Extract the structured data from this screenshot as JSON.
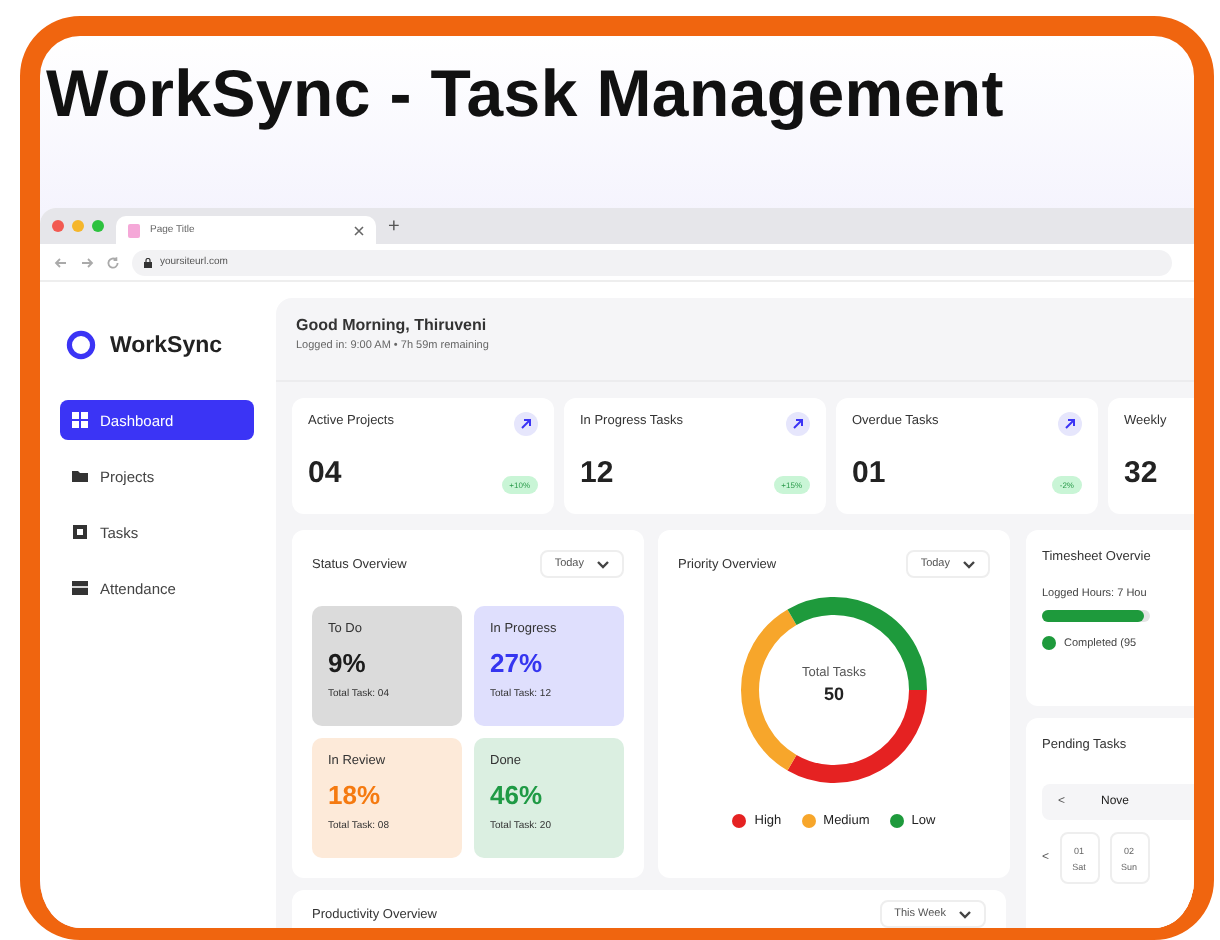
{
  "title": "WorkSync - Task Management",
  "browser": {
    "tab_title": "Page Title",
    "new_tab": "+",
    "address": "yoursiteurl.com"
  },
  "sidebar": {
    "brand": "WorkSync",
    "items": [
      {
        "label": "Dashboard",
        "selected": true,
        "kind": "grid"
      },
      {
        "label": "Projects",
        "selected": false,
        "kind": "folder"
      },
      {
        "label": "Tasks",
        "selected": false,
        "kind": "square"
      },
      {
        "label": "Attendance",
        "selected": false,
        "kind": "table"
      }
    ]
  },
  "header": {
    "greeting": "Good Morning, Thiruveni",
    "subtitle": "Logged in: 9:00 AM • 7h 59m remaining"
  },
  "stats": [
    {
      "label": "Active Projects",
      "value": "04",
      "change": "+10%"
    },
    {
      "label": "In Progress Tasks",
      "value": "12",
      "change": "+15%"
    },
    {
      "label": "Overdue Tasks",
      "value": "01",
      "change": "-2%"
    },
    {
      "label": "Weekly",
      "value": "32"
    }
  ],
  "status_overview": {
    "title": "Status Overview",
    "filter": "Today",
    "tiles": [
      {
        "name": "To Do",
        "percent": "9%",
        "total": "Total Task: 04",
        "color": "#1c1c1c"
      },
      {
        "name": "In Progress",
        "percent": "27%",
        "total": "Total Task: 12",
        "color": "#3535f0"
      },
      {
        "name": "In Review",
        "percent": "18%",
        "total": "Total Task: 08",
        "color": "#f57a10"
      },
      {
        "name": "Done",
        "percent": "46%",
        "total": "Total Task: 20",
        "color": "#1f9a45"
      }
    ]
  },
  "priority_overview": {
    "title": "Priority Overview",
    "filter": "Today",
    "center_label": "Total Tasks",
    "center_value": "50",
    "legend": [
      {
        "label": "High",
        "color": "#e52222"
      },
      {
        "label": "Medium",
        "color": "#f7a62b"
      },
      {
        "label": "Low",
        "color": "#1e9a3c"
      }
    ]
  },
  "timesheet": {
    "title": "Timesheet Overvie",
    "logged": "Logged Hours: 7 Hou",
    "level": 0.95,
    "completed": "Completed (95"
  },
  "pending": {
    "title": "Pending Tasks",
    "month_prev": "<",
    "month": "Nove",
    "day_prev": "<",
    "days": [
      {
        "day": "01",
        "weekday": "Sat"
      },
      {
        "day": "02",
        "weekday": "Sun"
      }
    ]
  },
  "productivity": {
    "title": "Productivity Overview",
    "filter": "This Week"
  }
}
